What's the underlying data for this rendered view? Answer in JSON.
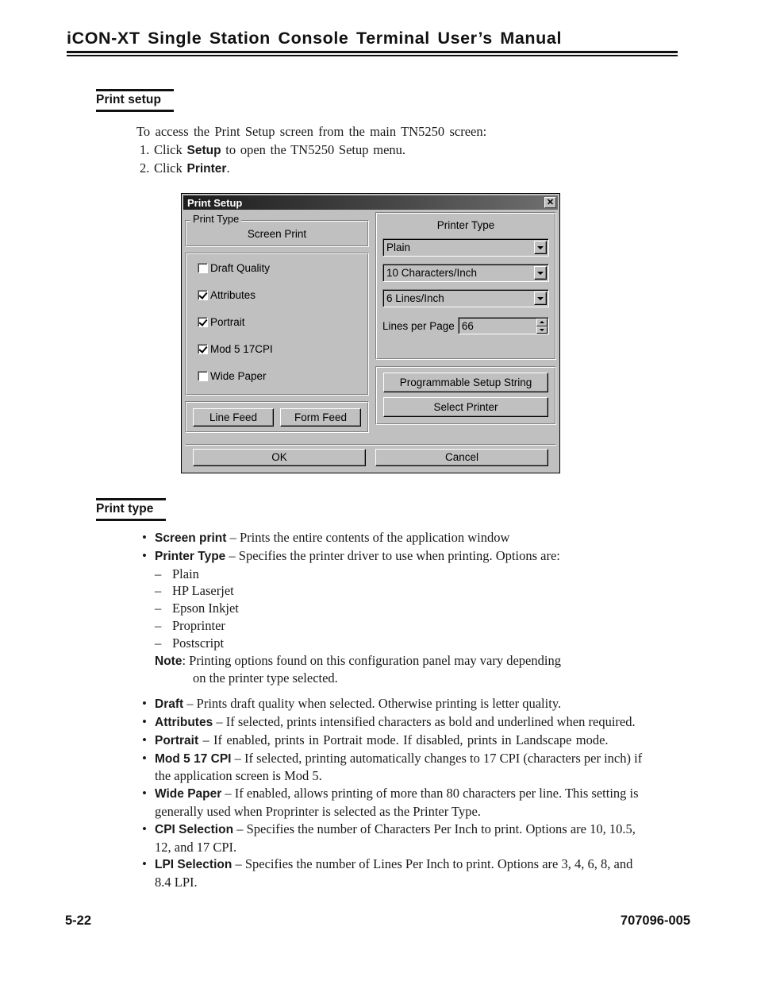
{
  "header": {
    "title": "iCON-XT Single Station Console Terminal User’s Manual"
  },
  "sections": {
    "print_setup": {
      "heading": "Print setup",
      "lead": "To access the Print Setup screen from the main TN5250 screen:",
      "steps": [
        {
          "num": "1.",
          "pre": "Click ",
          "bold": "Setup",
          "post": " to open the TN5250 Setup menu."
        },
        {
          "num": "2.",
          "pre": "Click ",
          "bold": "Printer",
          "post": "."
        }
      ]
    },
    "print_type": {
      "heading": "Print type"
    }
  },
  "dialog": {
    "title": "Print Setup",
    "close_label": "✕",
    "print_type_group": "Print Type",
    "screen_print_label": "Screen Print",
    "checkboxes": [
      {
        "label": "Draft Quality",
        "checked": false
      },
      {
        "label": "Attributes",
        "checked": true
      },
      {
        "label": "Portrait",
        "checked": true
      },
      {
        "label": "Mod 5 17CPI",
        "checked": true
      },
      {
        "label": "Wide Paper",
        "checked": false
      }
    ],
    "line_feed_label": "Line Feed",
    "form_feed_label": "Form Feed",
    "printer_type_title": "Printer Type",
    "printer_type_value": "Plain",
    "cpi_value": "10 Characters/Inch",
    "lpi_value": "6 Lines/Inch",
    "lines_per_page_label": "Lines per Page",
    "lines_per_page_value": "66",
    "programmable_setup_label": "Programmable Setup String",
    "select_printer_label": "Select Printer",
    "ok_label": "OK",
    "cancel_label": "Cancel"
  },
  "print_type_bullets": [
    {
      "term": "Screen print",
      "desc": " – Prints the entire contents of the application window"
    },
    {
      "term": "Printer Type",
      "desc": " – Specifies the printer driver to use when printing. Options are:"
    }
  ],
  "printer_type_options": [
    "Plain",
    "HP Laserjet",
    "Epson Inkjet",
    "Proprinter",
    "Postscript"
  ],
  "note": {
    "label": "Note",
    "line1": ": Printing options found on this configuration panel may vary depending",
    "line2": "on the printer type selected."
  },
  "option_bullets": [
    {
      "term": "Draft",
      "desc": " – Prints draft quality when selected. Otherwise printing is letter quality."
    },
    {
      "term": "Attributes",
      "desc": " – If selected, prints intensified characters as bold and underlined when required."
    },
    {
      "term": "Portrait",
      "desc": " – If enabled, prints in Portrait mode. If disabled, prints in Landscape mode."
    },
    {
      "term": "Mod 5 17 CPI",
      "desc": " – If selected, printing automatically changes to 17 CPI (characters per inch) if the application screen is Mod 5."
    },
    {
      "term": "Wide Paper",
      "desc": " – If enabled, allows printing of more than 80 characters per line. This setting is generally used when Proprinter is selected as the Printer Type."
    },
    {
      "term": "CPI Selection",
      "desc": " – Specifies the number of Characters Per Inch to print. Options are 10, 10.5, 12, and 17 CPI."
    },
    {
      "term": "LPI Selection",
      "desc": " – Specifies the number of Lines Per Inch to print. Options are 3, 4, 6, 8, and 8.4 LPI."
    }
  ],
  "footer": {
    "page_number": "5-22",
    "document_number": "707096-005"
  }
}
